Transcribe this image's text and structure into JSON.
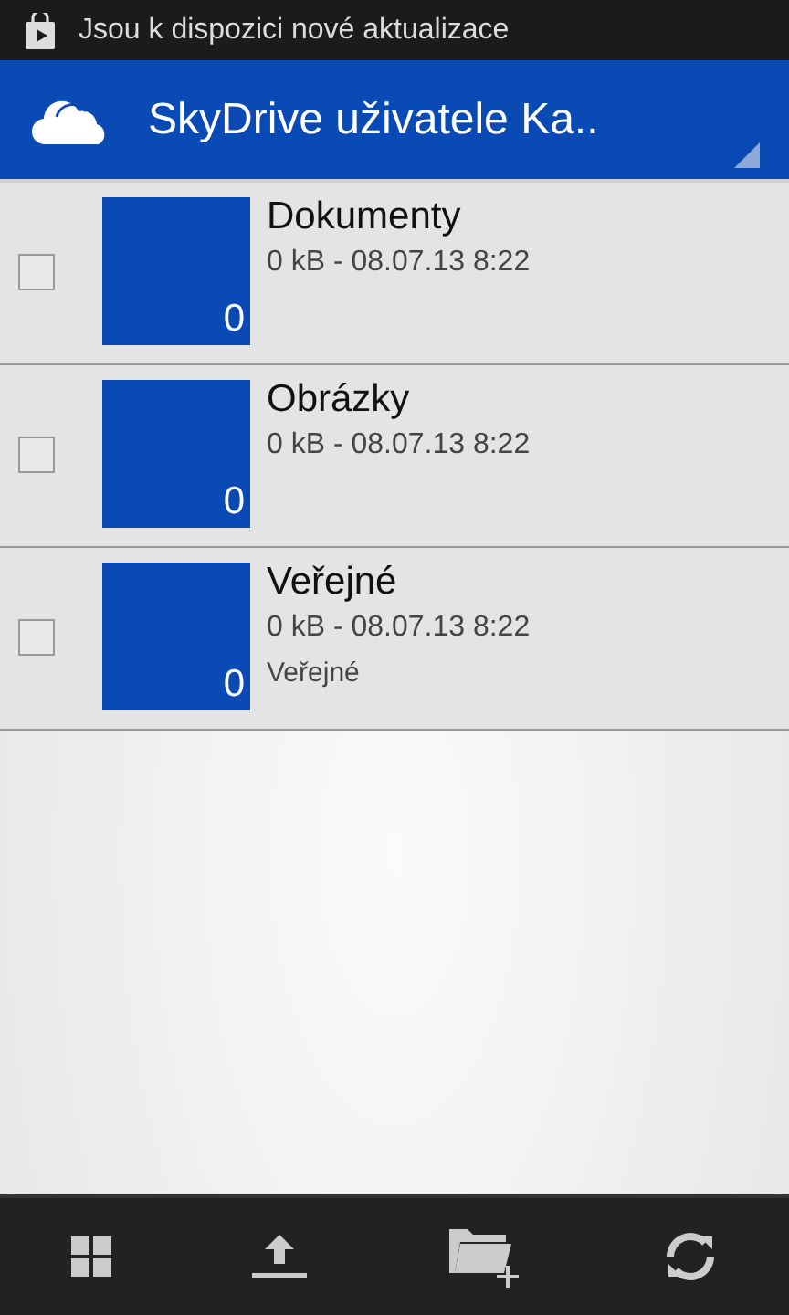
{
  "status_bar": {
    "notification": "Jsou k dispozici nové aktualizace"
  },
  "header": {
    "title": "SkyDrive uživatele Ka.."
  },
  "folders": [
    {
      "name": "Dokumenty",
      "info": "0 kB - 08.07.13 8:22",
      "count": "0",
      "checked": false
    },
    {
      "name": "Obrázky",
      "info": "0 kB - 08.07.13 8:22",
      "count": "0",
      "checked": false
    },
    {
      "name": "Veřejné",
      "info": "0 kB - 08.07.13 8:22",
      "note": "Veřejné",
      "count": "0",
      "checked": false
    }
  ]
}
